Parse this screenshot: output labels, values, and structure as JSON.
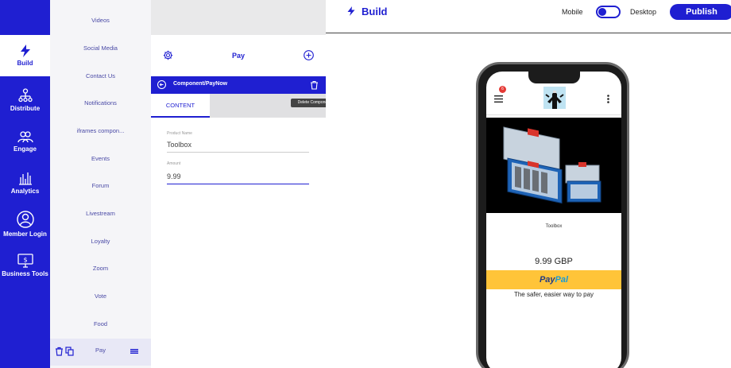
{
  "nav": {
    "items": [
      {
        "label": "Build",
        "icon": "bolt-icon",
        "active": true
      },
      {
        "label": "Distribute",
        "icon": "network-icon"
      },
      {
        "label": "Engage",
        "icon": "people-icon"
      },
      {
        "label": "Analytics",
        "icon": "bar-chart-icon"
      },
      {
        "label": "Member Login",
        "icon": "user-icon"
      },
      {
        "label": "Business Tools",
        "icon": "monitor-dollar-icon"
      }
    ]
  },
  "components": {
    "items": [
      "Videos",
      "Social Media",
      "Contact Us",
      "Notifications",
      "iframes compon...",
      "Events",
      "Forum",
      "Livestream",
      "Loyalty",
      "Zoom",
      "Vote",
      "Food"
    ],
    "selected": "Pay"
  },
  "editor": {
    "title": "Pay",
    "path": "Component/PayNow",
    "tooltip": "Delete Component",
    "tab_content": "CONTENT",
    "fields": {
      "product_name_label": "Product Name",
      "product_name_value": "Toolbox",
      "amount_label": "Amount",
      "amount_value": "9.99"
    }
  },
  "topbar": {
    "title": "Build",
    "mobile": "Mobile",
    "desktop": "Desktop",
    "publish": "Publish"
  },
  "preview": {
    "badge_count": "6",
    "product_name": "Toolbox",
    "price": "9.99 GBP",
    "paypal_part1": "Pay",
    "paypal_part2": "Pal",
    "paypal_tagline": "The safer, easier way to pay"
  },
  "colors": {
    "brand": "#1f1fd1",
    "paypal_yellow": "#ffc439"
  }
}
